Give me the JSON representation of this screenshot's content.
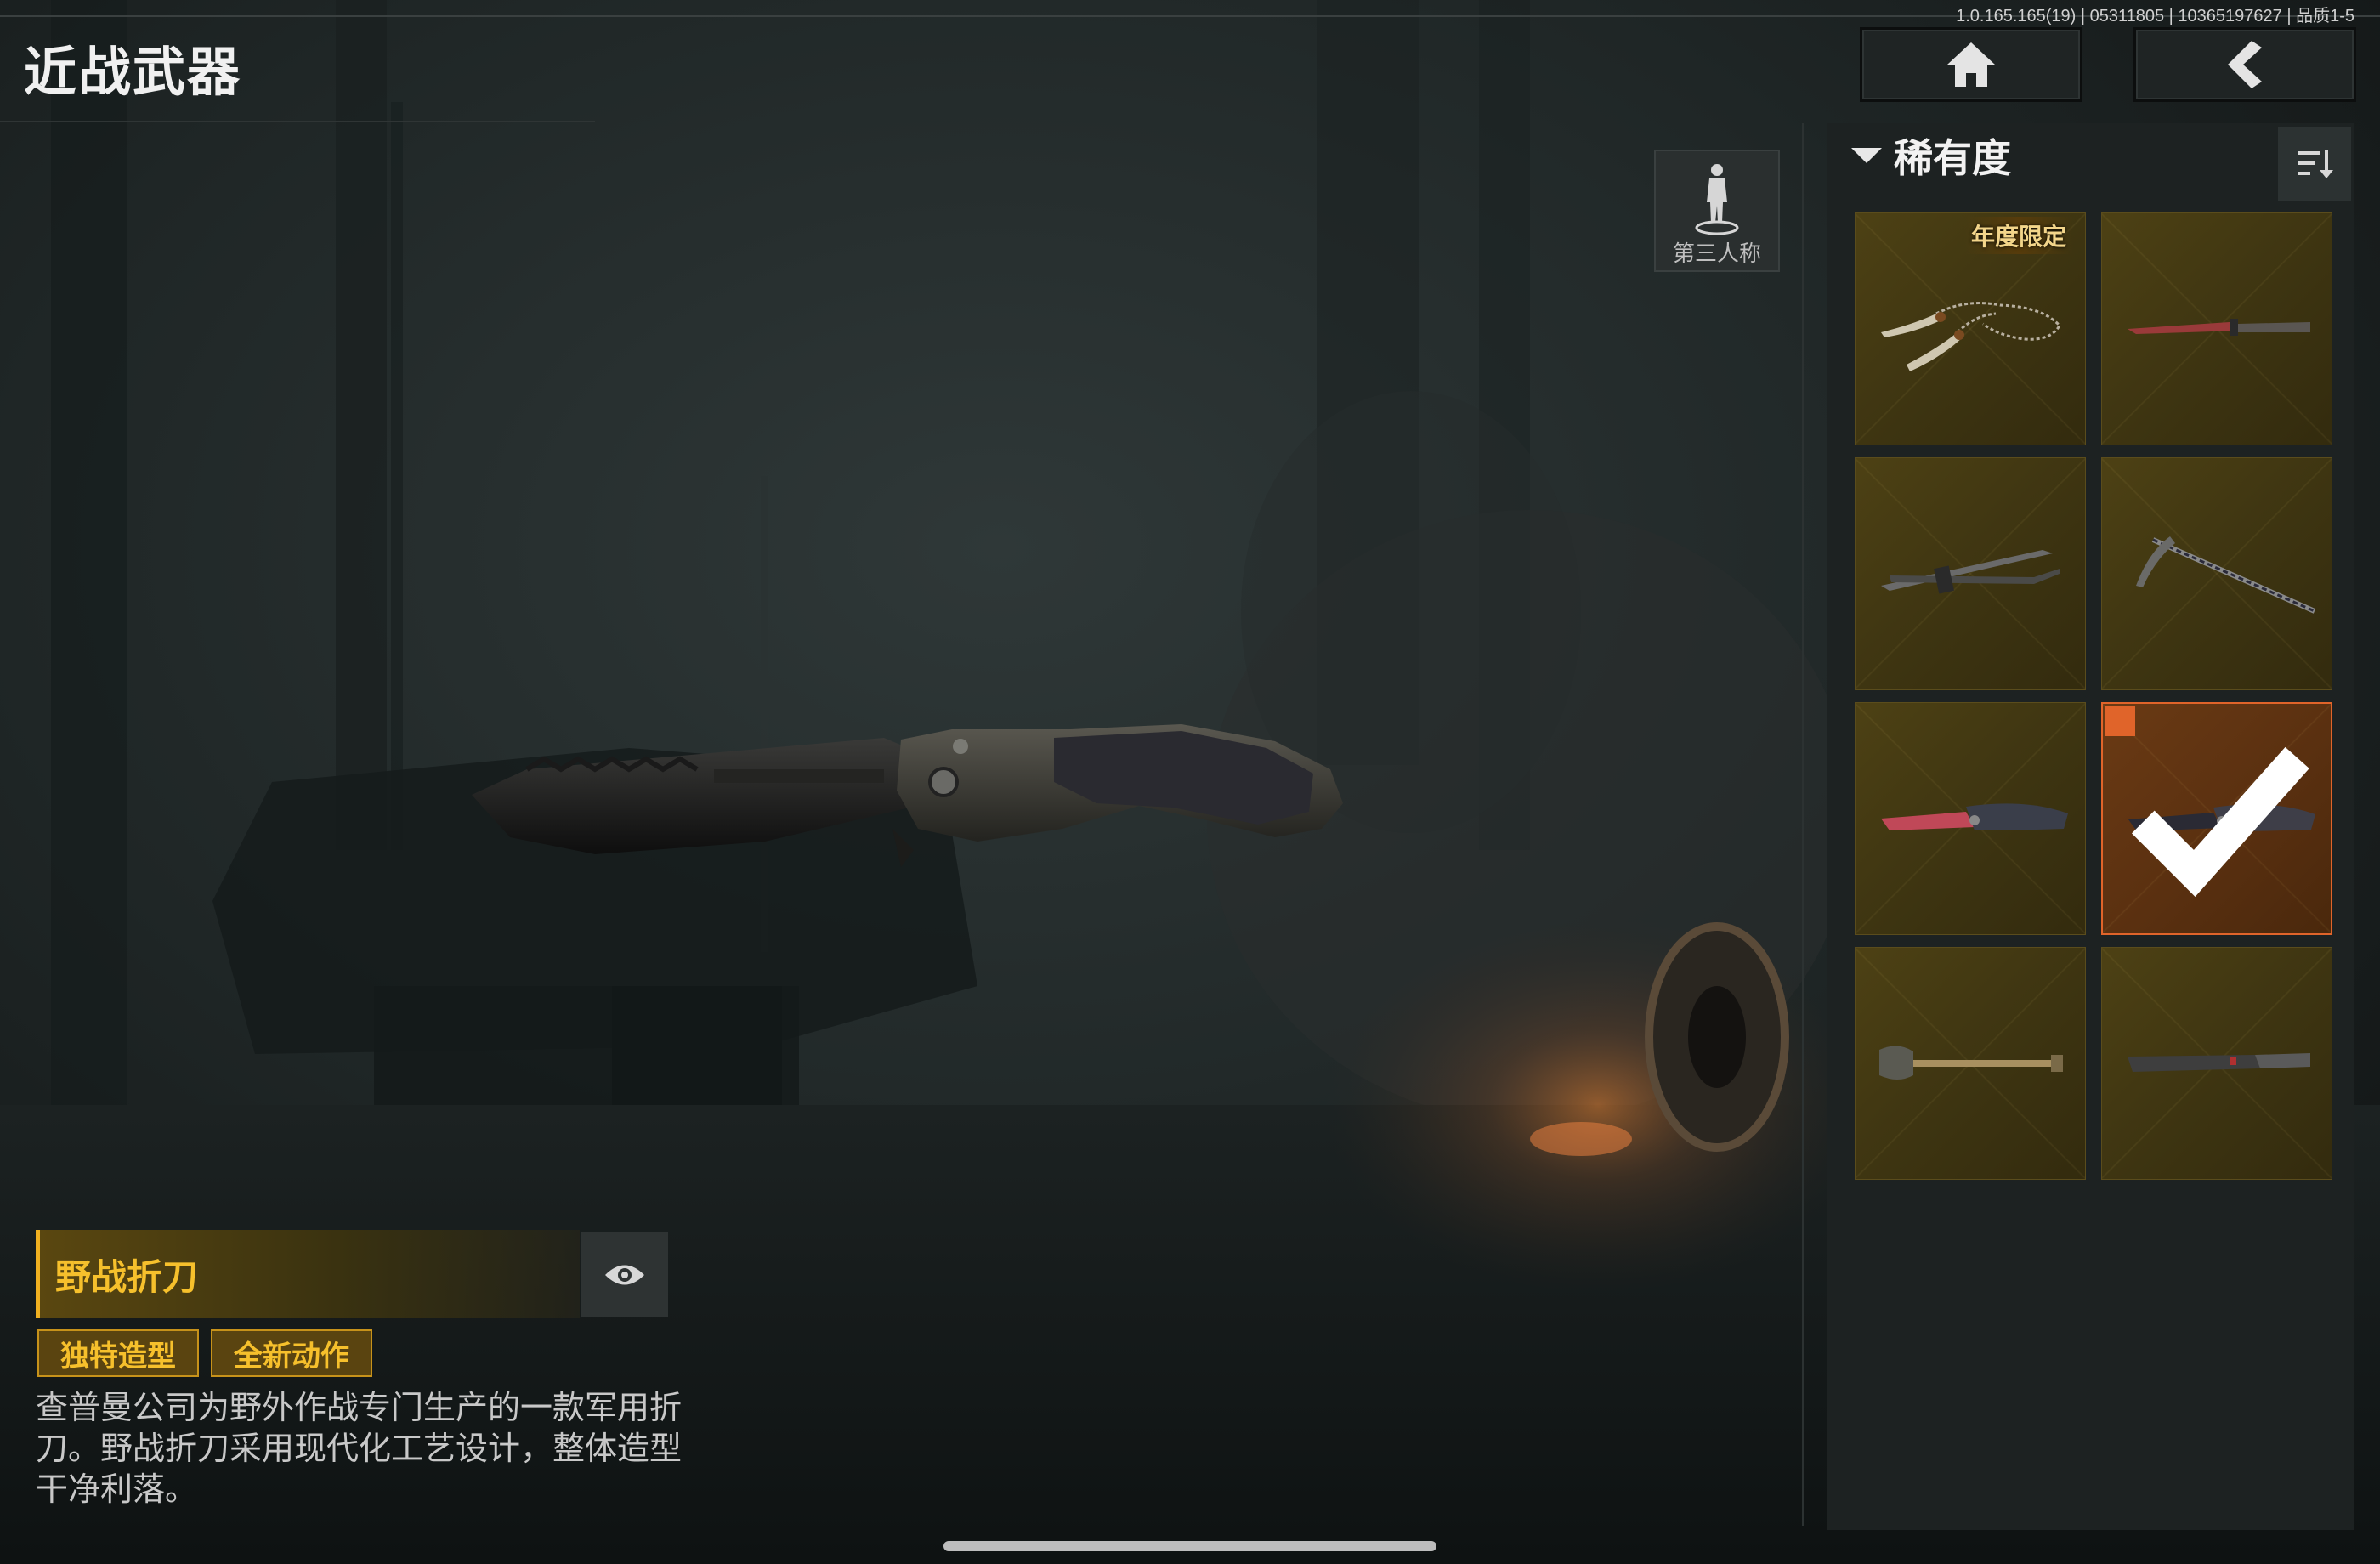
{
  "header": {
    "title": "近战武器",
    "version": "1.0.165.165(19) | 05311805 | 10365197627 | 品质1-5"
  },
  "nav": {
    "home_icon": "home-icon",
    "back_icon": "back-arrow-icon"
  },
  "view_toggle": {
    "label": "第三人称",
    "icon": "person-icon"
  },
  "panel": {
    "filter_label": "稀有度",
    "sort_icon": "sort-icon",
    "items": [
      {
        "id": 1,
        "badge": "年度限定",
        "icon": "chain-sickles-icon",
        "selected": false
      },
      {
        "id": 2,
        "badge": "",
        "icon": "red-blade-icon",
        "selected": false
      },
      {
        "id": 3,
        "badge": "",
        "icon": "twin-blades-icon",
        "selected": false
      },
      {
        "id": 4,
        "badge": "",
        "icon": "scythe-icon",
        "selected": false
      },
      {
        "id": 5,
        "badge": "",
        "icon": "red-folding-knife-icon",
        "selected": false
      },
      {
        "id": 6,
        "badge": "",
        "icon": "field-folding-knife-icon",
        "selected": true
      },
      {
        "id": 7,
        "badge": "",
        "icon": "shovel-icon",
        "selected": false
      },
      {
        "id": 8,
        "badge": "",
        "icon": "machete-icon",
        "selected": false
      }
    ]
  },
  "weapon": {
    "name": "野战折刀",
    "tags": [
      "独特造型",
      "全新动作"
    ],
    "description": "查普曼公司为野外作战专门生产的一款军用折刀。野战折刀采用现代化工艺设计，整体造型干净利落。"
  },
  "colors": {
    "accent_gold": "#f6c02c",
    "selected_border": "#e0642a",
    "cell_bg": "#3d3411",
    "panel_bg": "#1d2222"
  }
}
